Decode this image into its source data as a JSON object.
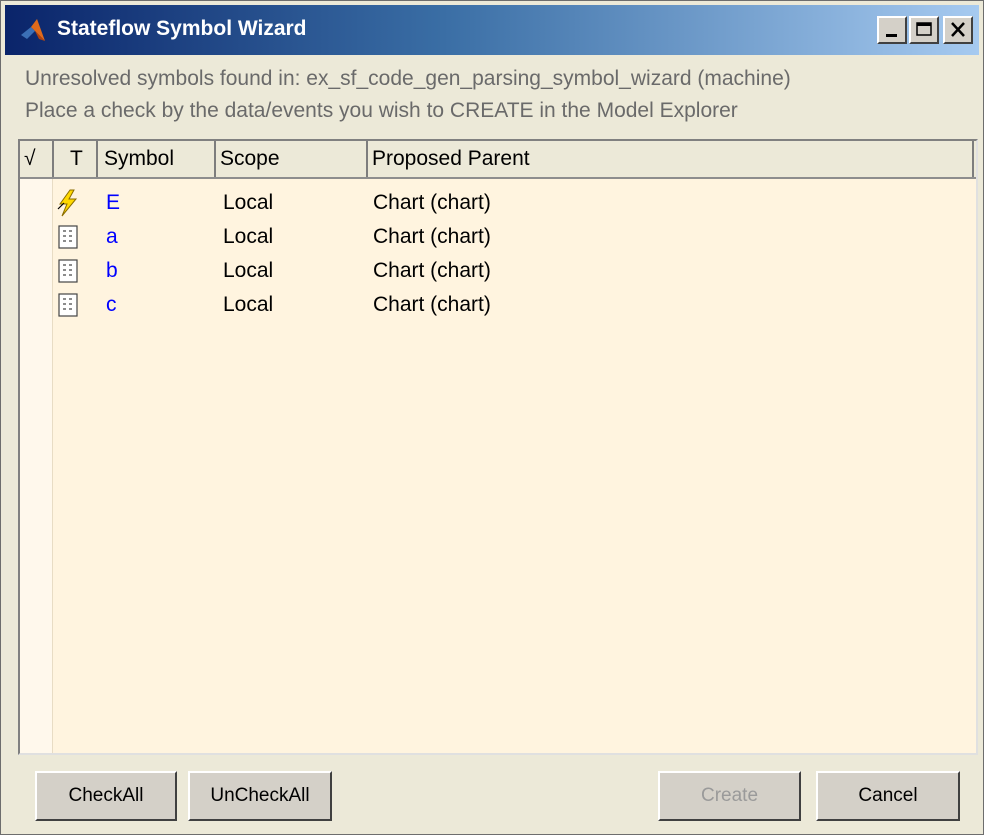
{
  "window": {
    "title": "Stateflow Symbol Wizard",
    "controls": [
      "minimize-icon",
      "maximize-icon",
      "close-icon"
    ]
  },
  "info": {
    "line1": "Unresolved symbols found in: ex_sf_code_gen_parsing_symbol_wizard (machine)",
    "line2": "Place a check by the data/events you wish to CREATE in the Model Explorer"
  },
  "table": {
    "headers": {
      "check": "√",
      "type": "T",
      "symbol": "Symbol",
      "scope": "Scope",
      "parent": "Proposed Parent"
    },
    "rows": [
      {
        "icon": "event-lightning-icon",
        "symbol": "E",
        "scope": "Local",
        "parent": "Chart (chart)"
      },
      {
        "icon": "data-icon",
        "symbol": "a",
        "scope": "Local",
        "parent": "Chart (chart)"
      },
      {
        "icon": "data-icon",
        "symbol": "b",
        "scope": "Local",
        "parent": "Chart (chart)"
      },
      {
        "icon": "data-icon",
        "symbol": "c",
        "scope": "Local",
        "parent": "Chart (chart)"
      }
    ]
  },
  "buttons": {
    "checkall": "CheckAll",
    "uncheckall": "UnCheckAll",
    "create": "Create",
    "cancel": "Cancel"
  },
  "colors": {
    "symbol_text": "#0000ff",
    "table_bg": "#fff4df",
    "disabled_text": "#9a9a9a"
  }
}
